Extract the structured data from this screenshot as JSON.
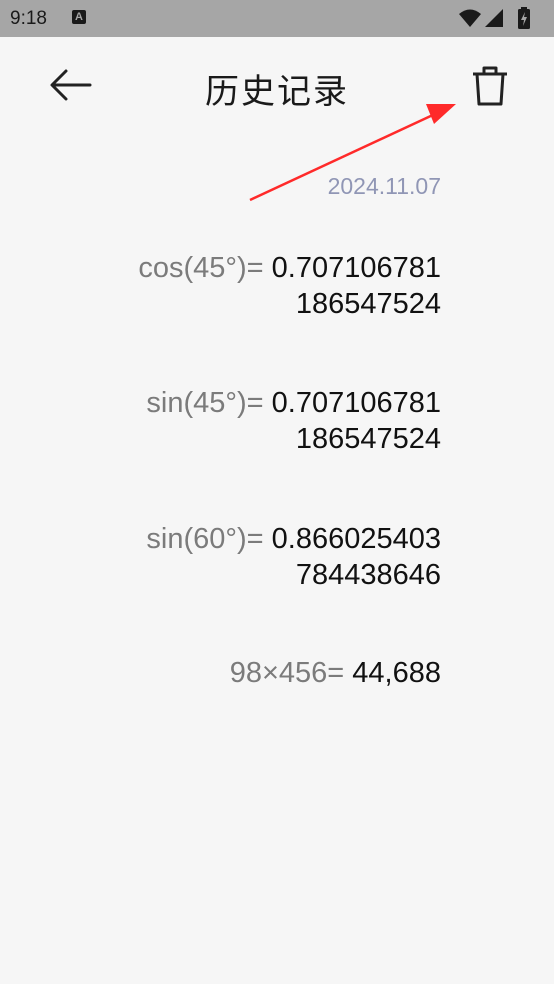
{
  "status_bar": {
    "time": "9:18",
    "notif_icon": "A",
    "icons": [
      "wifi-icon",
      "signal-icon",
      "battery-icon"
    ]
  },
  "appbar": {
    "title": "历史记录",
    "back_icon": "arrow-left-icon",
    "delete_icon": "trash-icon"
  },
  "history": {
    "date": "2024.11.07",
    "records": [
      {
        "expr": "cos(45°)=",
        "result_line1": "0.707106781",
        "result_line2": "186547524"
      },
      {
        "expr": "sin(45°)=",
        "result_line1": "0.707106781",
        "result_line2": "186547524"
      },
      {
        "expr": "sin(60°)=",
        "result_line1": "0.866025403",
        "result_line2": "784438646"
      },
      {
        "expr": "98×456=",
        "result_line1": "44,688"
      }
    ]
  },
  "colors": {
    "background": "#f6f6f6",
    "status_bar": "#a6a6a6",
    "date_text": "#9096b5",
    "expression_text": "#7b7b7b",
    "result_text": "#111111",
    "annotation_arrow": "#ff2a2a"
  }
}
